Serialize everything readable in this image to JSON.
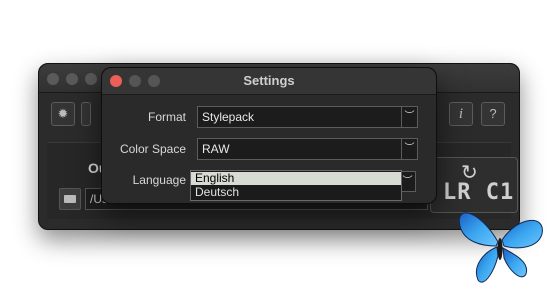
{
  "background_app": {
    "output_label": "Out",
    "path_value": "/Use",
    "convert_button": "LR C1",
    "toolbar": {
      "settings_icon": "gear-icon",
      "info_label": "i",
      "help_label": "?"
    }
  },
  "dialog": {
    "title": "Settings",
    "format": {
      "label": "Format",
      "value": "Stylepack"
    },
    "color_space": {
      "label": "Color Space",
      "value": "RAW"
    },
    "language": {
      "label": "Language",
      "options": [
        "English",
        "Deutsch"
      ],
      "selected": "English"
    }
  },
  "colors": {
    "close_button": "#ec5f58",
    "accent_selection": "#d7dbd4",
    "butterfly_blue": "#2d8fe0"
  }
}
